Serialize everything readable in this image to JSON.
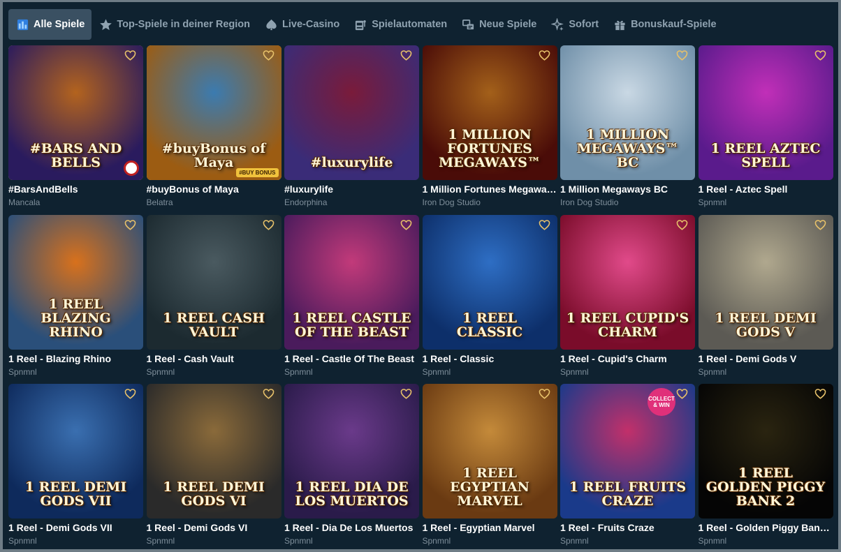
{
  "tabs": [
    {
      "label": "Alle Spiele",
      "icon": "grid-icon",
      "active": true
    },
    {
      "label": "Top-Spiele in deiner Region",
      "icon": "star-icon",
      "active": false
    },
    {
      "label": "Live-Casino",
      "icon": "spade-icon",
      "active": false
    },
    {
      "label": "Spielautomaten",
      "icon": "slot-machine-icon",
      "active": false
    },
    {
      "label": "Neue Spiele",
      "icon": "new-badge-icon",
      "active": false
    },
    {
      "label": "Sofort",
      "icon": "sparkle-icon",
      "active": false
    },
    {
      "label": "Bonuskauf-Spiele",
      "icon": "gift-icon",
      "active": false
    }
  ],
  "games": [
    {
      "title": "#BarsAndBells",
      "provider": "Mancala",
      "logo": "#BARS AND BELLS",
      "bg": [
        "#2a1b5e",
        "#b3631e"
      ]
    },
    {
      "title": "#buyBonus of Maya",
      "provider": "Belatra",
      "logo": "#buyBonus of Maya",
      "badge": "#BUY BONUS",
      "bg": [
        "#9c5c12",
        "#3b7bb0"
      ]
    },
    {
      "title": "#luxurylife",
      "provider": "Endorphina",
      "logo": "#luxurylife",
      "bg": [
        "#3a2c78",
        "#7a1b3a"
      ]
    },
    {
      "title": "1 Million Fortunes Megaways",
      "provider": "Iron Dog Studio",
      "logo": "1 MILLION FORTUNES MEGAWAYS™",
      "bg": [
        "#4a0c08",
        "#a3601a"
      ]
    },
    {
      "title": "1 Million Megaways BC",
      "provider": "Iron Dog Studio",
      "logo": "1 MILLION MEGAWAYS™ BC",
      "bg": [
        "#6f8fa8",
        "#c9d8e4"
      ]
    },
    {
      "title": "1 Reel - Aztec Spell",
      "provider": "Spnmnl",
      "logo": "1 REEL AZTEC SPELL",
      "bg": [
        "#5a1b8c",
        "#c12fb8"
      ]
    },
    {
      "title": "1 Reel - Blazing Rhino",
      "provider": "Spnmnl",
      "logo": "1 REEL BLAZING RHINO",
      "bg": [
        "#2a4f7a",
        "#d8711c"
      ]
    },
    {
      "title": "1 Reel - Cash Vault",
      "provider": "Spnmnl",
      "logo": "1 REEL CASH VAULT",
      "bg": [
        "#1c2a30",
        "#4a5a60"
      ]
    },
    {
      "title": "1 Reel - Castle Of The Beast",
      "provider": "Spnmnl",
      "logo": "1 REEL CASTLE OF THE BEAST",
      "bg": [
        "#4a1b5c",
        "#c23a7a"
      ]
    },
    {
      "title": "1 Reel - Classic",
      "provider": "Spnmnl",
      "logo": "1 REEL CLASSIC",
      "bg": [
        "#0d2f6a",
        "#2e6ec4"
      ]
    },
    {
      "title": "1 Reel - Cupid's Charm",
      "provider": "Spnmnl",
      "logo": "1 REEL CUPID'S CHARM",
      "bg": [
        "#7a0c2a",
        "#e14a8a"
      ]
    },
    {
      "title": "1 Reel - Demi Gods V",
      "provider": "Spnmnl",
      "logo": "1 REEL DEMI GODS V",
      "bg": [
        "#5c5a54",
        "#b0a88e"
      ]
    },
    {
      "title": "1 Reel - Demi Gods VII",
      "provider": "Spnmnl",
      "logo": "1 REEL DEMI GODS VII",
      "bg": [
        "#0e2a5c",
        "#3a6fb0"
      ]
    },
    {
      "title": "1 Reel - Demi Gods VI",
      "provider": "Spnmnl",
      "logo": "1 REEL DEMI GODS VI",
      "bg": [
        "#2a2a2a",
        "#8a6a3a"
      ]
    },
    {
      "title": "1 Reel - Dia De Los Muertos",
      "provider": "Spnmnl",
      "logo": "1 REEL DIA DE LOS MUERTOS",
      "bg": [
        "#2a1b4a",
        "#6a3a8a"
      ]
    },
    {
      "title": "1 Reel - Egyptian Marvel",
      "provider": "Spnmnl",
      "logo": "1 REEL EGYPTIAN MARVEL",
      "bg": [
        "#6a3a12",
        "#c48a3a"
      ]
    },
    {
      "title": "1 Reel - Fruits Craze",
      "provider": "Spnmnl",
      "logo": "1 REEL FRUITS CRAZE",
      "bg": [
        "#1a3a8a",
        "#c2306a"
      ],
      "sticker": "COLLECT & WIN"
    },
    {
      "title": "1 Reel - Golden Piggy Bank 2",
      "provider": "Spnmnl",
      "logo": "1 REEL GOLDEN PIGGY BANK 2",
      "bg": [
        "#050505",
        "#2a2410"
      ]
    }
  ],
  "colors": {
    "background": "#0f2230",
    "tab_active": "#3a5062",
    "tab_text": "#8fa2b0",
    "favorite": "#e7c16a",
    "provider_text": "#7f8f9b"
  }
}
